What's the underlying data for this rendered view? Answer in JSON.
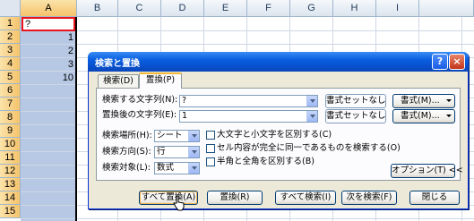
{
  "sheet": {
    "columns": [
      "A",
      "B",
      "C",
      "D",
      "E",
      "F",
      "G",
      "H",
      "I"
    ],
    "rows": [
      "1",
      "2",
      "3",
      "4",
      "5",
      "6",
      "7",
      "8",
      "9",
      "10",
      "11",
      "12",
      "13",
      "14",
      "15"
    ],
    "cells": {
      "a1": "?",
      "a2": "1",
      "a3": "2",
      "a4": "3",
      "a5": "10"
    },
    "selected_column": "A",
    "active_cell_color": "#e8131b",
    "selection_color": "#b6c8e4"
  },
  "dialog": {
    "title": "検索と置換",
    "help_glyph": "?",
    "close_glyph": "×",
    "tabs": [
      {
        "label": "検索(D)",
        "active": false
      },
      {
        "label": "置換(P)",
        "active": true
      }
    ],
    "find_label": "検索する文字列(N):",
    "find_value": "?",
    "replace_label": "置換後の文字列(E):",
    "replace_value": "1",
    "format_none_1": "書式セットなし",
    "format_none_2": "書式セットなし",
    "format_btn_1": "書式(M)...",
    "format_btn_2": "書式(M)...",
    "within_label": "検索場所(H):",
    "within_value": "シート",
    "search_label": "検索方向(S):",
    "search_value": "行",
    "lookin_label": "検索対象(L):",
    "lookin_value": "数式",
    "match_case": "大文字と小文字を区別する(C)",
    "match_entire": "セル内容が完全に同一であるものを検索する(O)",
    "match_byte": "半角と全角を区別する(B)",
    "options_btn": "オプション(T) <<",
    "replace_all_btn": "すべて置換(A)",
    "replace_btn": "置換(R)",
    "find_all_btn": "すべて検索(I)",
    "find_next_btn": "次を検索(F)",
    "close_btn": "閉じる",
    "title_color": "#0a5fe0"
  },
  "icons": [
    "help-icon",
    "close-icon",
    "dropdown-arrow-icon",
    "checkbox-icon",
    "mouse-pointer-icon"
  ]
}
